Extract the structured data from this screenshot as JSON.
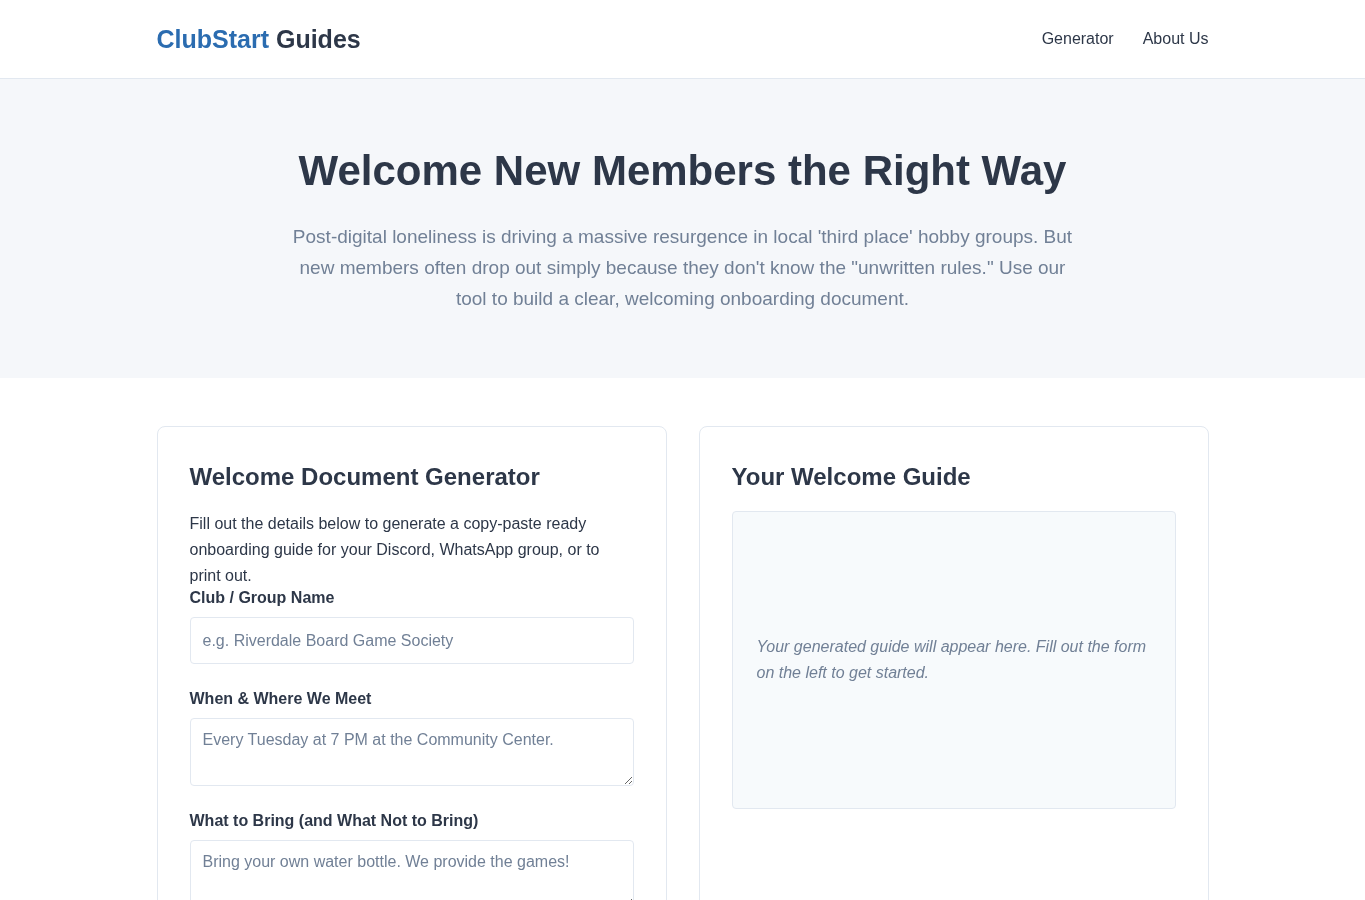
{
  "brand": {
    "primary": "ClubStart",
    "secondary": "Guides"
  },
  "nav": [
    {
      "label": "Generator"
    },
    {
      "label": "About Us"
    }
  ],
  "hero": {
    "title": "Welcome New Members the Right Way",
    "text": "Post-digital loneliness is driving a massive resurgence in local 'third place' hobby groups. But new members often drop out simply because they don't know the \"unwritten rules.\" Use our tool to build a clear, welcoming onboarding document."
  },
  "generator": {
    "title": "Welcome Document Generator",
    "intro": "Fill out the details below to generate a copy-paste ready onboarding guide for your Discord, WhatsApp group, or to print out.",
    "fields": [
      {
        "kind": "input",
        "label": "Club / Group Name",
        "placeholder": "e.g. Riverdale Board Game Society"
      },
      {
        "kind": "textarea",
        "label": "When & Where We Meet",
        "placeholder": "Every Tuesday at 7 PM at the Community Center."
      },
      {
        "kind": "textarea",
        "label": "What to Bring (and What Not to Bring)",
        "placeholder": "Bring your own water bottle. We provide the games!"
      }
    ]
  },
  "guide": {
    "title": "Your Welcome Guide",
    "placeholder": "Your generated guide will appear here. Fill out the form on the left to get started."
  }
}
